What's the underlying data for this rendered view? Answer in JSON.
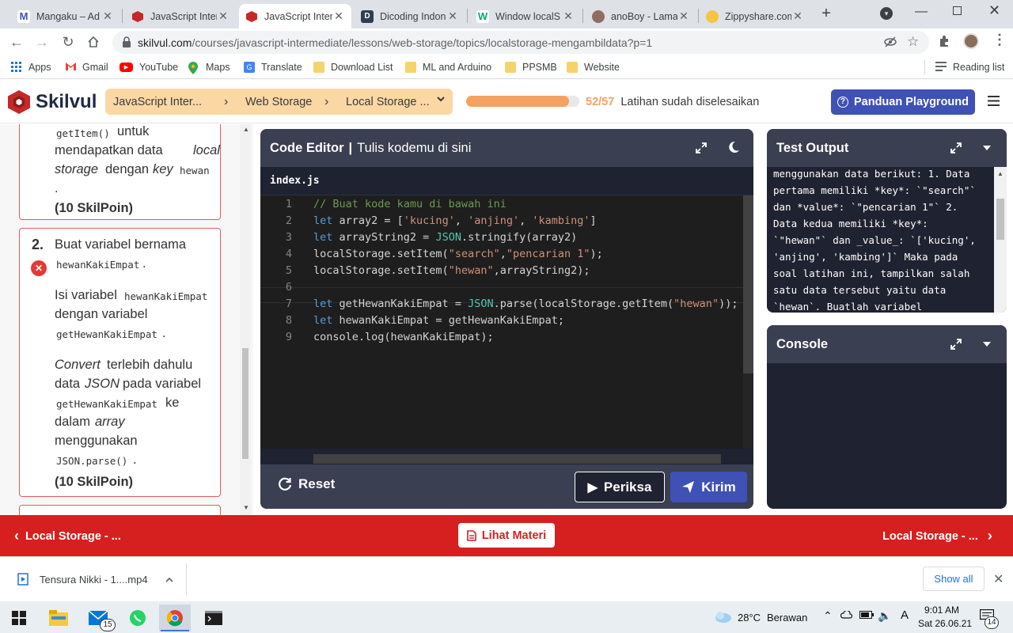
{
  "browser": {
    "tabs": [
      {
        "title": "Mangaku – Ad",
        "icon": "mangaku-favicon",
        "color": "#3f51b5",
        "letter": "M"
      },
      {
        "title": "JavaScript Inter",
        "icon": "skilvul-favicon",
        "color": "#c62828",
        "letter": ""
      },
      {
        "title": "JavaScript Inter",
        "icon": "skilvul-favicon",
        "color": "#c62828",
        "letter": "",
        "active": true
      },
      {
        "title": "Dicoding Indon",
        "icon": "dicoding-favicon",
        "color": "#2d3e50",
        "letter": "D"
      },
      {
        "title": "Window localS",
        "icon": "w3schools-favicon",
        "color": "#04aa6d",
        "letter": "W"
      },
      {
        "title": "anoBoy - Lama",
        "icon": "anoboy-favicon",
        "color": "#8d6e63",
        "letter": ""
      },
      {
        "title": "Zippyshare.com",
        "icon": "zippyshare-favicon",
        "color": "#f5c542",
        "letter": ""
      }
    ],
    "url_host": "skilvul.com",
    "url_path": "/courses/javascript-intermediate/lessons/web-storage/topics/localstorage-mengambildata?p=1",
    "bookmarks": [
      "Apps",
      "Gmail",
      "YouTube",
      "Maps",
      "Translate",
      "Download List",
      "ML and Arduino",
      "PPSMB",
      "Website"
    ],
    "reading_list": "Reading list"
  },
  "header": {
    "logo": "Skilvul",
    "crumb1": "JavaScript Inter...",
    "crumb2": "Web Storage",
    "crumb3": "Local Storage ...",
    "progress_text": "52/57",
    "progress_fraction": 0.912,
    "progress_label": "Latihan sudah diselesaikan",
    "guide_button": "Panduan Playground"
  },
  "tasks": {
    "t1_code": "getItem()",
    "t1_a": "untuk",
    "t1_b": "mendapatkan data",
    "t1_c": "local",
    "t1_d": "storage",
    "t1_e": "dengan",
    "t1_f": "key",
    "t1_g": "hewan",
    "t1_h": ".",
    "t1_points": "(10 SkilPoin)",
    "t2_num": "2.",
    "t2_a": "Buat variabel bernama",
    "t2_b": "hewanKakiEmpat",
    "t2_b2": ".",
    "t2_c": "Isi variabel",
    "t2_d": "hewanKakiEmpat",
    "t2_e": "dengan variabel",
    "t2_f": "getHewanKakiEmpat",
    "t2_f2": ".",
    "t2_g": "Convert",
    "t2_h": "terlebih dahulu",
    "t2_i": "data",
    "t2_j": "JSON",
    "t2_k": "pada variabel",
    "t2_l": "getHewanKakiEmpat",
    "t2_m": "ke",
    "t2_n": "dalam",
    "t2_o": "array",
    "t2_p": "menggunakan",
    "t2_q": "JSON.parse()",
    "t2_q2": ".",
    "t2_points": "(10 SkilPoin)"
  },
  "editor": {
    "title": "Code Editor",
    "subtitle": "Tulis kodemu di sini",
    "filename": "index.js",
    "line_numbers": [
      "1",
      "2",
      "3",
      "4",
      "5",
      "6",
      "7",
      "8",
      "9"
    ],
    "reset": "Reset",
    "periksa": "Periksa",
    "kirim": "Kirim"
  },
  "code": {
    "l1": "// Buat kode kamu di bawah ini",
    "l2a": "let",
    "l2b": " array2 = [",
    "l2c": "'kucing'",
    "l2d": ", ",
    "l2e": "'anjing'",
    "l2f": ", ",
    "l2g": "'kambing'",
    "l2h": "]",
    "l3a": "let",
    "l3b": " arrayString2 = ",
    "l3c": "JSON",
    "l3d": ".stringify(array2)",
    "l4a": "localStorage.setItem(",
    "l4b": "\"search\"",
    "l4c": ",",
    "l4d": "\"pencarian 1\"",
    "l4e": ");",
    "l5a": "localStorage.setItem(",
    "l5b": "\"hewan\"",
    "l5c": ",arrayString2);",
    "l7a": "let",
    "l7b": " getHewanKakiEmpat = ",
    "l7c": "JSON",
    "l7d": ".parse(localStorage.getItem(",
    "l7e": "\"hewan\"",
    "l7f": "));",
    "l8a": "let",
    "l8b": " hewanKakiEmpat = getHewanKakiEmpat;",
    "l9": "console.log(hewanKakiEmpat);"
  },
  "test_output": {
    "title": "Test Output",
    "text": "menggunakan data berikut: 1. Data\npertama memiliki *key*: `\"search\"`\ndan *value*: `\"pencarian 1\"` 2.\nData kedua memiliki *key*:\n`\"hewan\"` dan _value_: `['kucing',\n'anjing', 'kambing']` Maka pada\nsoal latihan ini, tampilkan salah\nsatu data tersebut yaitu data\n`hewan`. Buatlah variabel"
  },
  "console": {
    "title": "Console"
  },
  "footer": {
    "prev": "Local Storage - ...",
    "materi": "Lihat Materi",
    "next": "Local Storage - ..."
  },
  "downloads": {
    "file": "Tensura Nikki - 1....mp4",
    "show_all": "Show all"
  },
  "taskbar": {
    "mail_badge": "15",
    "weather": "28°C",
    "weather_desc": "Berawan",
    "time": "9:01 AM",
    "date": "Sat 26.06.21",
    "notif_badge": "14"
  },
  "colors": {
    "accent": "#3f51b5",
    "brand_red": "#d62020",
    "progress": "#f4a261",
    "crumb_bg": "#fbd7a4",
    "error": "#e53935"
  }
}
